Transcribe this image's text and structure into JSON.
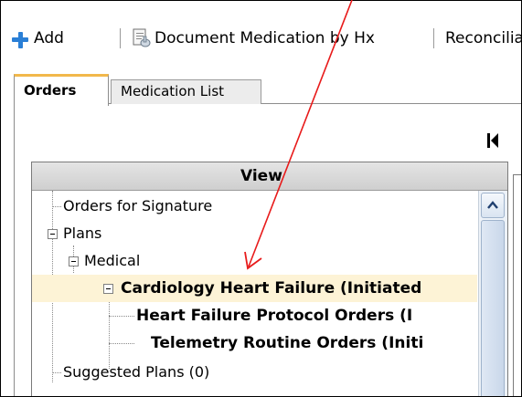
{
  "toolbar": {
    "add_label": "Add",
    "document_label": "Document Medication by Hx",
    "reconciliation_label": "Reconciliatio"
  },
  "tabs": [
    {
      "label": "Orders",
      "active": true
    },
    {
      "label": "Medication List",
      "active": false
    }
  ],
  "view": {
    "header": "View",
    "rows": [
      {
        "label": "Orders for Signature",
        "level": 0,
        "toggle": false,
        "bold": false,
        "selected": false
      },
      {
        "label": "Plans",
        "level": 0,
        "toggle": true,
        "bold": false,
        "selected": false
      },
      {
        "label": "Medical",
        "level": 1,
        "toggle": true,
        "bold": false,
        "selected": false
      },
      {
        "label": "Cardiology Heart Failure (Initiated",
        "level": 2,
        "toggle": true,
        "bold": true,
        "selected": true
      },
      {
        "label": "Heart Failure Protocol Orders (I",
        "level": 3,
        "toggle": false,
        "bold": true,
        "selected": false
      },
      {
        "label": "Telemetry Routine Orders (Initi",
        "level": 3,
        "toggle": false,
        "bold": true,
        "selected": false
      },
      {
        "label": "Suggested Plans (0)",
        "level": 0,
        "toggle": false,
        "bold": false,
        "selected": false
      }
    ]
  },
  "colors": {
    "annotation_arrow": "#e81b1b",
    "tab_accent": "#f2b84b",
    "plus_icon": "#2a7fd6",
    "selected_row": "#fdf3d6"
  },
  "icons": [
    "plus-icon",
    "document-medication-icon",
    "nav-first-icon",
    "scroll-up-icon",
    "collapse-toggle-icon"
  ]
}
